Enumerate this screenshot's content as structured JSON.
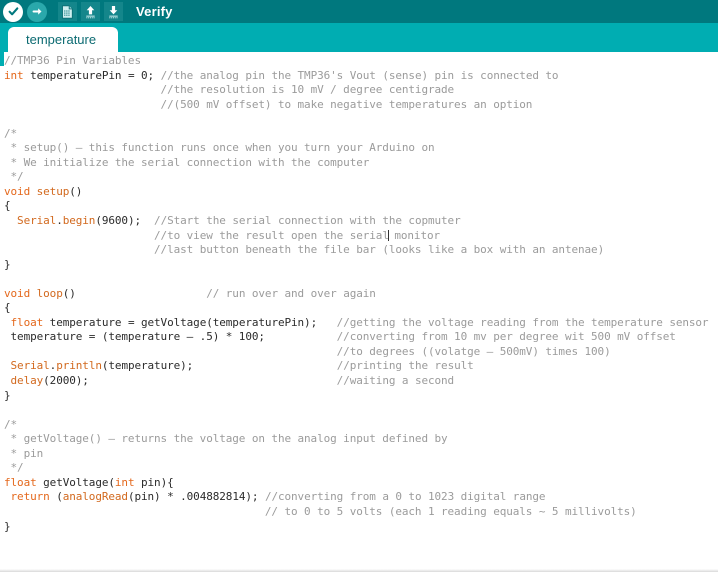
{
  "window": {
    "title": "Verify"
  },
  "toolbar": {
    "title": "Verify",
    "buttons": [
      {
        "name": "verify-button",
        "icon": "checkmark-icon",
        "label": "Verify"
      },
      {
        "name": "upload-button",
        "icon": "arrow-right-icon",
        "label": "Upload"
      },
      {
        "name": "new-button",
        "icon": "new-document-icon",
        "label": "New"
      },
      {
        "name": "open-button",
        "icon": "arrow-up-icon",
        "label": "Open"
      },
      {
        "name": "save-button",
        "icon": "arrow-down-icon",
        "label": "Save"
      }
    ],
    "colors": {
      "background": "#00787e",
      "icon_tile": "#14868b",
      "upload_circle": "#2aa8ab",
      "verify_circle": "#ffffff",
      "title_text": "#ffffff"
    }
  },
  "tabbar": {
    "background": "#00adb2",
    "tabs": [
      {
        "name": "tab-temperature",
        "label": "temperature",
        "active": true
      }
    ]
  },
  "editor": {
    "colors": {
      "background": "#ffffff",
      "text": "#2b2b2b",
      "comment": "#9b9b9b",
      "keyword": "#e4681c",
      "function": "#d2691e"
    },
    "caret_position": "after 'serial' on line '//to view the result open the serial monitor'",
    "lines": [
      "//TMP36 Pin Variables",
      "int temperaturePin = 0; //the analog pin the TMP36's Vout (sense) pin is connected to",
      "                        //the resolution is 10 mV / degree centigrade",
      "                        //(500 mV offset) to make negative temperatures an option",
      "",
      "/*",
      " * setup() – this function runs once when you turn your Arduino on",
      " * We initialize the serial connection with the computer",
      " */",
      "void setup()",
      "{",
      "  Serial.begin(9600);  //Start the serial connection with the copmuter",
      "                       //to view the result open the serial monitor",
      "                       //last button beneath the file bar (looks like a box with an antenae)",
      "}",
      "",
      "void loop()                    // run over and over again",
      "{",
      " float temperature = getVoltage(temperaturePin);   //getting the voltage reading from the temperature sensor",
      " temperature = (temperature – .5) * 100;           //converting from 10 mv per degree wit 500 mV offset",
      "                                                   //to degrees ((volatge – 500mV) times 100)",
      " Serial.println(temperature);                      //printing the result",
      " delay(2000);                                      //waiting a second",
      "}",
      "",
      "/*",
      " * getVoltage() – returns the voltage on the analog input defined by",
      " * pin",
      " */",
      "float getVoltage(int pin){",
      " return (analogRead(pin) * .004882814); //converting from a 0 to 1023 digital range",
      "                                        // to 0 to 5 volts (each 1 reading equals ~ 5 millivolts)",
      "}"
    ]
  }
}
